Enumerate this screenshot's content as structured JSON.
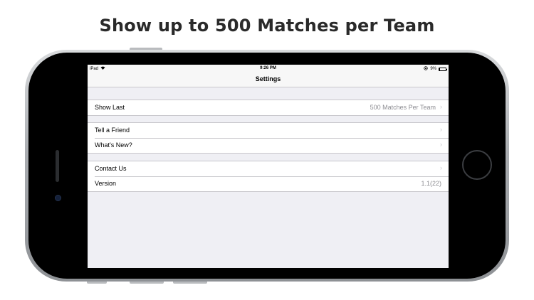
{
  "headline": "Show up to 500 Matches per Team",
  "status_bar": {
    "carrier": "iPad",
    "time": "9:26 PM",
    "battery": "9%"
  },
  "nav": {
    "title": "Settings"
  },
  "groups": [
    {
      "rows": [
        {
          "label": "Show Last",
          "value": "500 Matches Per Team",
          "chevron": "›"
        }
      ]
    },
    {
      "rows": [
        {
          "label": "Tell a Friend",
          "chevron": "›"
        },
        {
          "label": "What's New?",
          "chevron": "›"
        }
      ]
    },
    {
      "rows": [
        {
          "label": "Contact Us",
          "chevron": "›"
        },
        {
          "label": "Version",
          "value": "1.1(22)"
        }
      ]
    }
  ],
  "icons": [
    "wifi-icon",
    "lock-rotation-icon",
    "battery-icon",
    "chevron-right-icon"
  ],
  "colors": {
    "background": "#efeff4",
    "separator": "#c8c7cc",
    "secondary_text": "#8e8e93",
    "chevron": "#c7c7cc",
    "headline": "#2a2a2a"
  }
}
